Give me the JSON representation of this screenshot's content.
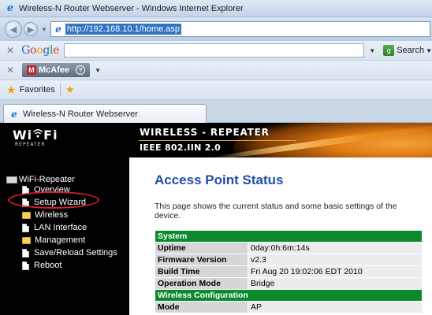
{
  "window": {
    "title": "Wireless-N Router Webserver - Windows Internet Explorer"
  },
  "address_bar": {
    "url": "http://192.168.10.1/home.asp"
  },
  "google_toolbar": {
    "logo": "Google",
    "search_label": "Search"
  },
  "mcafee_toolbar": {
    "label": "McAfee"
  },
  "favorites_bar": {
    "label": "Favorites"
  },
  "tab": {
    "label": "Wireless-N Router Webserver"
  },
  "header": {
    "logo_word": "Wi  Fi",
    "logo_sub": "REPEATER",
    "title": "WIRELESS - REPEATER",
    "subtitle": "IEEE 802.IIN 2.0"
  },
  "sidebar": {
    "root": "WiFi-Repeater",
    "items": [
      {
        "label": "Overview",
        "icon": "page-icon"
      },
      {
        "label": "Setup Wizard",
        "icon": "page-icon"
      },
      {
        "label": "Wireless",
        "icon": "folder-icon"
      },
      {
        "label": "LAN Interface",
        "icon": "page-icon"
      },
      {
        "label": "Management",
        "icon": "folder-icon"
      },
      {
        "label": "Save/Reload Settings",
        "icon": "page-icon"
      },
      {
        "label": "Reboot",
        "icon": "page-icon"
      }
    ]
  },
  "main": {
    "title": "Access Point Status",
    "description": "This page shows the current status and some basic settings of the device.",
    "system_header": "System",
    "rows": [
      {
        "label": "Uptime",
        "value": "0day:0h:6m:14s"
      },
      {
        "label": "Firmware Version",
        "value": "v2.3"
      },
      {
        "label": "Build Time",
        "value": "Fri Aug 20 19:02:06 EDT 2010"
      },
      {
        "label": "Operation Mode",
        "value": "Bridge"
      }
    ],
    "wireless_header": "Wireless Configuration",
    "partial_row": {
      "label": "Mode",
      "value": "AP"
    }
  },
  "colors": {
    "section_header": "#0a8a2c",
    "title_blue": "#1f4fa5",
    "highlight_ring": "#d91e2a"
  }
}
